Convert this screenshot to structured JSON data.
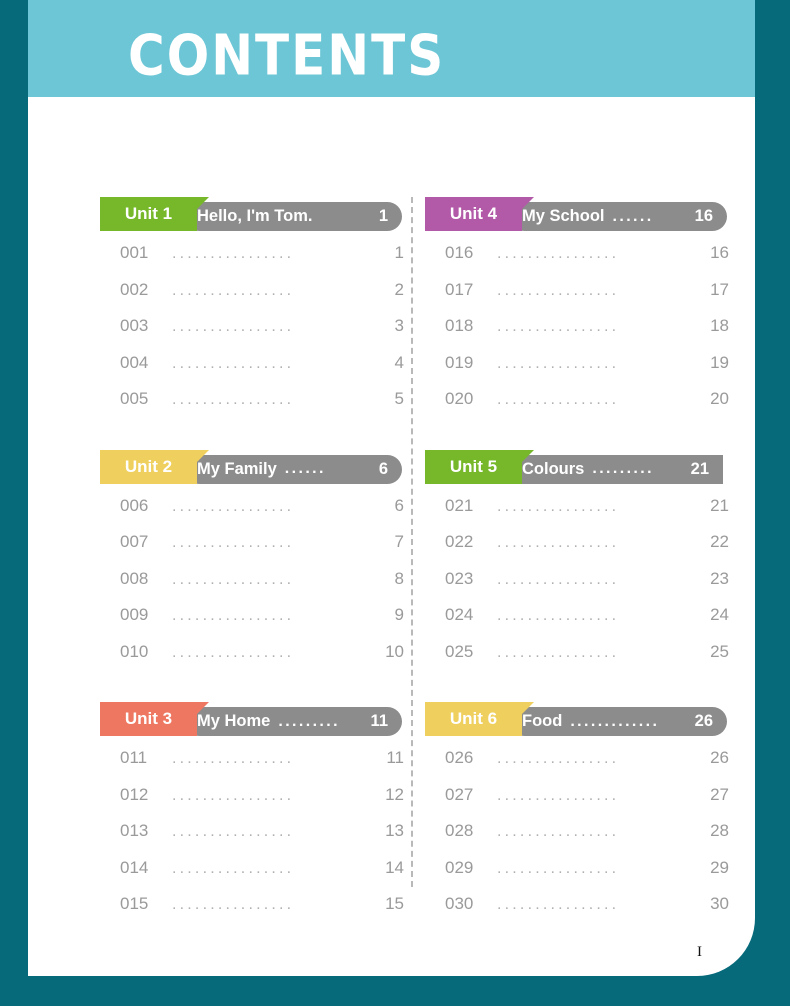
{
  "page": {
    "title": "CONTENTS",
    "folio": "I",
    "colors": {
      "border_teal": "#066A7B",
      "header_teal": "#6CC6D6",
      "bar_grey": "#8c8c8c",
      "text_grey": "#9a9a9a",
      "green": "#76B82A",
      "yellow": "#EFD05E",
      "coral": "#EE7761",
      "purple": "#B259A8"
    }
  },
  "columns": [
    {
      "name": "left-column",
      "units": [
        {
          "tab": "Unit 1",
          "color": "#76B82A",
          "title": "Hello, I'm Tom.",
          "dots": "",
          "page": "1",
          "squared": false,
          "entries": [
            {
              "code": "001",
              "dots": "................",
              "page": "1"
            },
            {
              "code": "002",
              "dots": "................",
              "page": "2"
            },
            {
              "code": "003",
              "dots": "................",
              "page": "3"
            },
            {
              "code": "004",
              "dots": "................",
              "page": "4"
            },
            {
              "code": "005",
              "dots": "................",
              "page": "5"
            }
          ]
        },
        {
          "tab": "Unit 2",
          "color": "#EFD05E",
          "title": "My Family",
          "dots": "......",
          "page": "6",
          "squared": false,
          "entries": [
            {
              "code": "006",
              "dots": "................",
              "page": "6"
            },
            {
              "code": "007",
              "dots": "................",
              "page": "7"
            },
            {
              "code": "008",
              "dots": "................",
              "page": "8"
            },
            {
              "code": "009",
              "dots": "................",
              "page": "9"
            },
            {
              "code": "010",
              "dots": "................",
              "page": "10"
            }
          ]
        },
        {
          "tab": "Unit 3",
          "color": "#EE7761",
          "title": "My Home",
          "dots": ".........",
          "page": "11",
          "squared": false,
          "entries": [
            {
              "code": "011",
              "dots": "................",
              "page": "11"
            },
            {
              "code": "012",
              "dots": "................",
              "page": "12"
            },
            {
              "code": "013",
              "dots": "................",
              "page": "13"
            },
            {
              "code": "014",
              "dots": "................",
              "page": "14"
            },
            {
              "code": "015",
              "dots": "................",
              "page": "15"
            }
          ]
        }
      ]
    },
    {
      "name": "right-column",
      "units": [
        {
          "tab": "Unit 4",
          "color": "#B259A8",
          "title": "My School",
          "dots": "......",
          "page": "16",
          "squared": false,
          "entries": [
            {
              "code": "016",
              "dots": "................",
              "page": "16"
            },
            {
              "code": "017",
              "dots": "................",
              "page": "17"
            },
            {
              "code": "018",
              "dots": "................",
              "page": "18"
            },
            {
              "code": "019",
              "dots": "................",
              "page": "19"
            },
            {
              "code": "020",
              "dots": "................",
              "page": "20"
            }
          ]
        },
        {
          "tab": "Unit 5",
          "color": "#76B82A",
          "title": "Colours",
          "dots": ".........",
          "page": "21",
          "squared": true,
          "entries": [
            {
              "code": "021",
              "dots": "................",
              "page": "21"
            },
            {
              "code": "022",
              "dots": "................",
              "page": "22"
            },
            {
              "code": "023",
              "dots": "................",
              "page": "23"
            },
            {
              "code": "024",
              "dots": "................",
              "page": "24"
            },
            {
              "code": "025",
              "dots": "................",
              "page": "25"
            }
          ]
        },
        {
          "tab": "Unit 6",
          "color": "#EFD05E",
          "title": "Food",
          "dots": ".............",
          "page": "26",
          "squared": false,
          "entries": [
            {
              "code": "026",
              "dots": "................",
              "page": "26"
            },
            {
              "code": "027",
              "dots": "................",
              "page": "27"
            },
            {
              "code": "028",
              "dots": "................",
              "page": "28"
            },
            {
              "code": "029",
              "dots": "................",
              "page": "29"
            },
            {
              "code": "030",
              "dots": "................",
              "page": "30"
            }
          ]
        }
      ]
    }
  ]
}
